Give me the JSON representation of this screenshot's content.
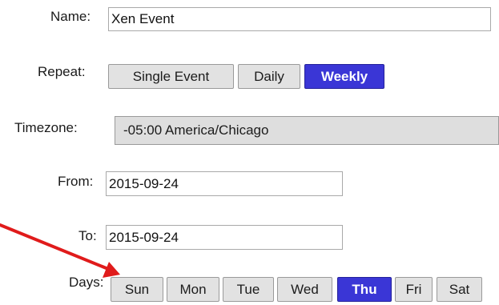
{
  "form": {
    "name": {
      "label": "Name:",
      "value": "Xen Event"
    },
    "repeat": {
      "label": "Repeat:",
      "options": [
        "Single Event",
        "Daily",
        "Weekly"
      ],
      "selected": "Weekly"
    },
    "timezone": {
      "label": "Timezone:",
      "value": "-05:00 America/Chicago"
    },
    "from": {
      "label": "From:",
      "value": "2015-09-24"
    },
    "to": {
      "label": "To:",
      "value": "2015-09-24"
    },
    "days": {
      "label": "Days:",
      "options": [
        "Sun",
        "Mon",
        "Tue",
        "Wed",
        "Thu",
        "Fri",
        "Sat"
      ],
      "selected": "Thu"
    }
  },
  "colors": {
    "active_button": "#3a36d6",
    "inactive_button": "#e2e2e2",
    "annotation_arrow": "#e01b1b"
  },
  "annotation": {
    "icon": "red-arrow-icon"
  }
}
